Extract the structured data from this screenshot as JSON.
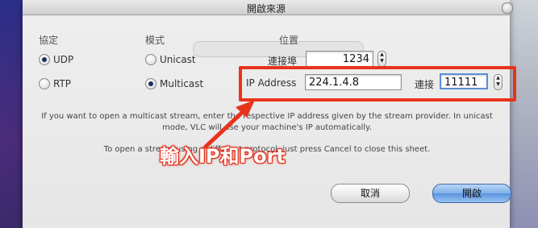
{
  "window": {
    "title": "開啟來源"
  },
  "protocol": {
    "heading": "協定",
    "options": [
      {
        "label": "UDP",
        "selected": true
      },
      {
        "label": "RTP",
        "selected": false
      }
    ]
  },
  "mode": {
    "heading": "模式",
    "options": [
      {
        "label": "Unicast",
        "selected": false
      },
      {
        "label": "Multicast",
        "selected": true
      }
    ]
  },
  "location": {
    "heading": "位置",
    "port_label": "連接埠",
    "port_value": "1234"
  },
  "multicast": {
    "ip_label": "IP Address",
    "ip_value": "224.1.4.8",
    "port_label": "連接",
    "port_value": "11111"
  },
  "info": {
    "line1": "If you want to open a multicast stream, enter the respective IP address given by the stream provider. In unicast",
    "line2": "mode, VLC will use your machine's IP automatically.",
    "line3": "To open a stream using a different protocol, just press Cancel to close this sheet."
  },
  "buttons": {
    "cancel": "取消",
    "open": "開啟"
  },
  "annotation": {
    "text": "輸入IP和Port",
    "color": "#e8331c"
  }
}
